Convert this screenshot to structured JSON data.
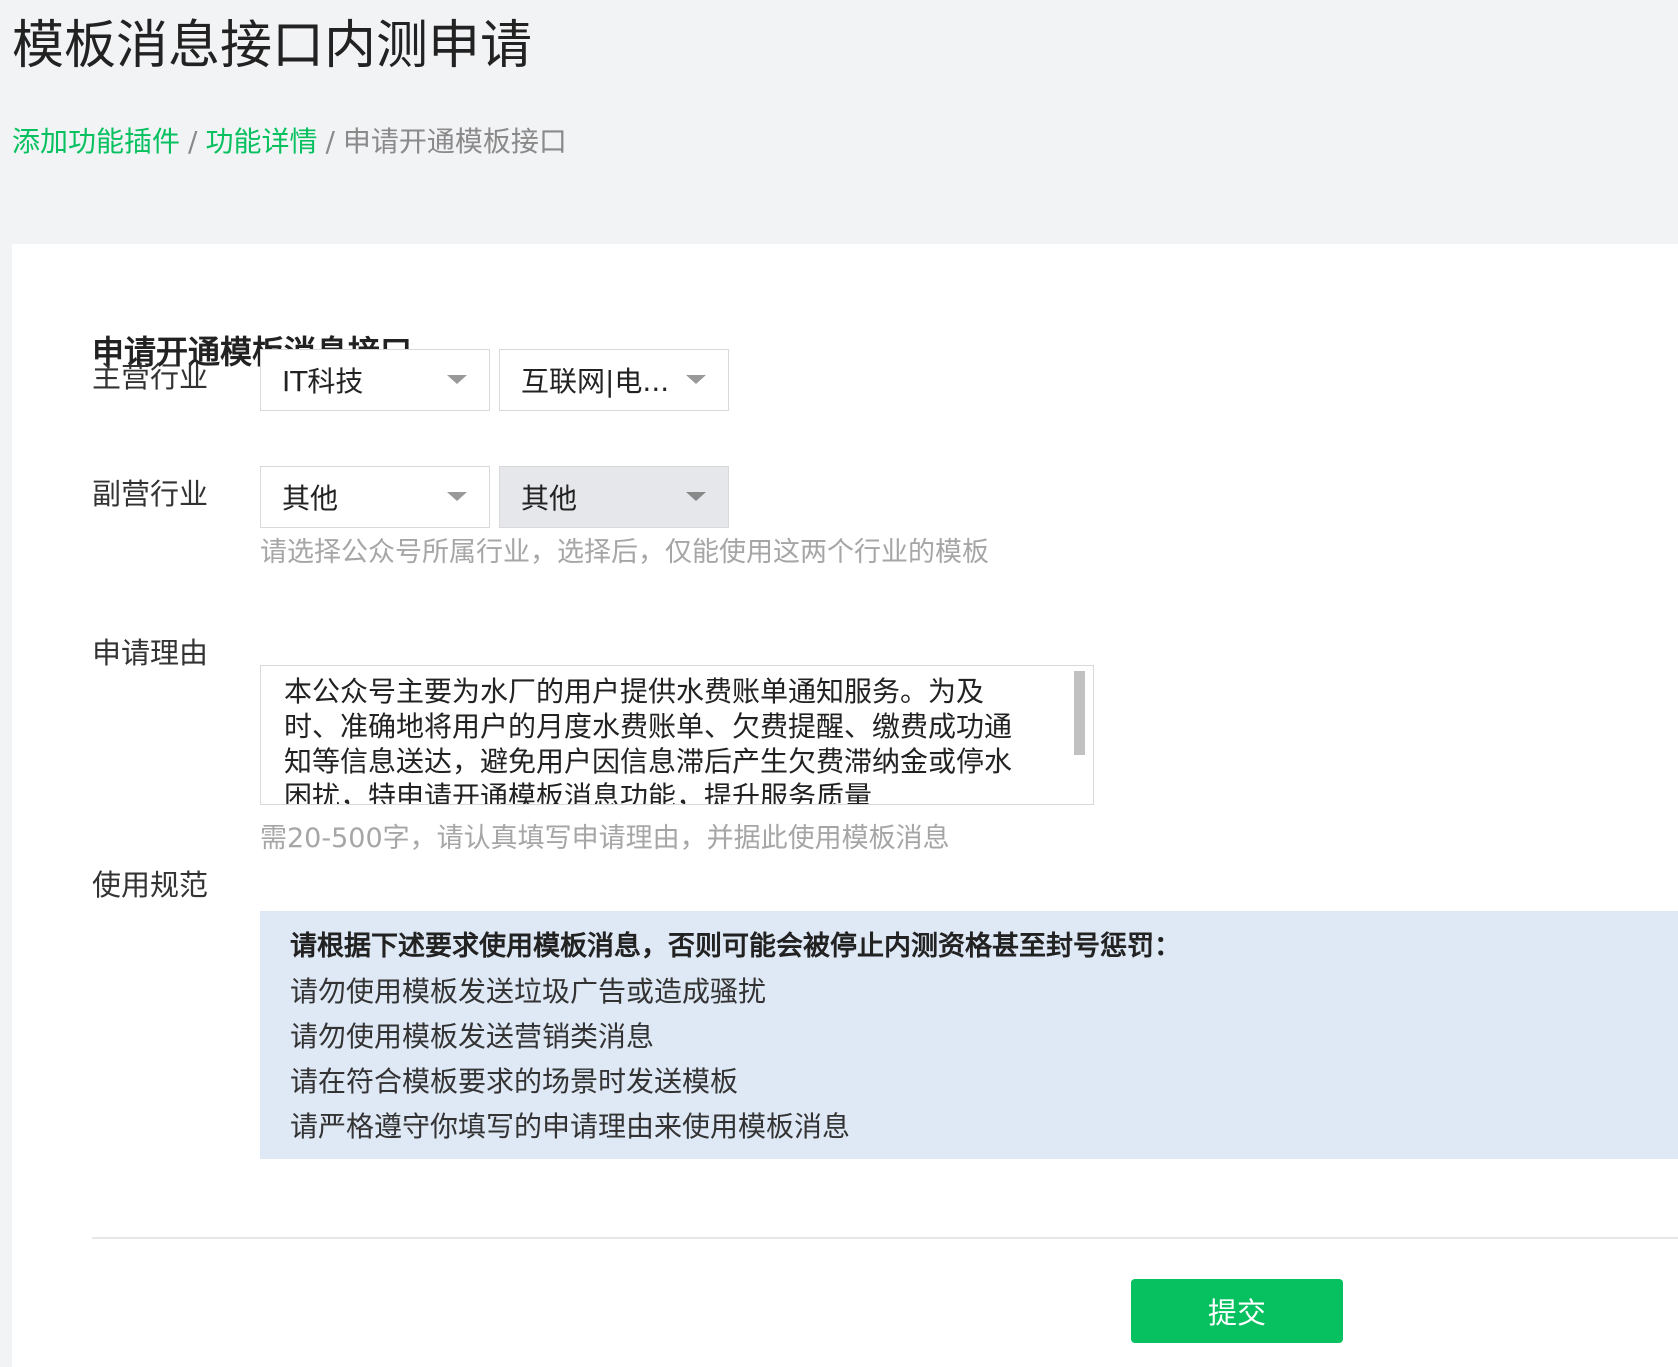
{
  "page": {
    "title": "模板消息接口内测申请"
  },
  "breadcrumb": {
    "items": [
      {
        "label": "添加功能插件",
        "link": true
      },
      {
        "label": "功能详情",
        "link": true
      },
      {
        "label": "申请开通模板接口",
        "link": false
      }
    ],
    "separator": "/"
  },
  "form": {
    "section_title": "申请开通模板消息接口",
    "primary_industry": {
      "label": "主营行业",
      "level1": "IT科技",
      "level2": "互联网|电..."
    },
    "secondary_industry": {
      "label": "副营行业",
      "level1": "其他",
      "level2": "其他",
      "hint": "请选择公众号所属行业，选择后，仅能使用这两个行业的模板"
    },
    "reason": {
      "label": "申请理由",
      "value": "本公众号主要为水厂的用户提供水费账单通知服务。为及时、准确地将用户的月度水费账单、欠费提醒、缴费成功通知等信息送达，避免用户因信息滞后产生欠费滞纳金或停水困扰，特申请开通模板消息功能，提升服务质量",
      "hint": "需20-500字，请认真填写申请理由，并据此使用模板消息"
    },
    "rules": {
      "label": "使用规范",
      "title": "请根据下述要求使用模板消息，否则可能会被停止内测资格甚至封号惩罚：",
      "items": [
        "请勿使用模板发送垃圾广告或造成骚扰",
        "请勿使用模板发送营销类消息",
        "请在符合模板要求的场景时发送模板",
        "请严格遵守你填写的申请理由来使用模板消息"
      ]
    },
    "submit_label": "提交"
  },
  "colors": {
    "accent": "#07c160",
    "background": "#f2f3f5",
    "rules_background": "#dfe8f5"
  }
}
